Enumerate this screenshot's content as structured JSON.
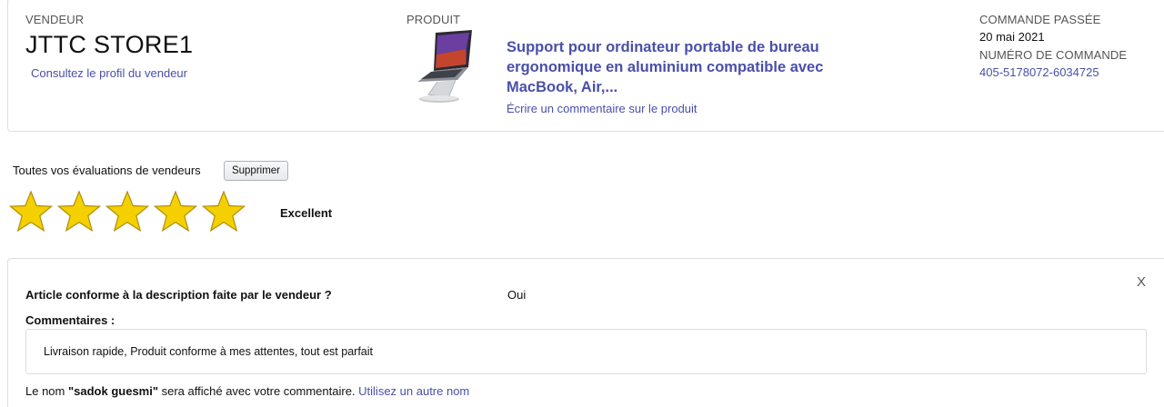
{
  "seller": {
    "heading": "VENDEUR",
    "name": "JTTC STORE1",
    "profile_link": "Consultez le profil du vendeur"
  },
  "product": {
    "heading": "PRODUIT",
    "title": "Support pour ordinateur portable de bureau ergonomique en aluminium compatible avec MacBook, Air,...",
    "review_link": "Écrire un commentaire sur le produit",
    "image_icon": "laptop-stand-image"
  },
  "order": {
    "placed_heading": "COMMANDE PASSÉE",
    "date": "20 mai 2021",
    "number_heading": "NUMÉRO DE COMMANDE",
    "number": "405-5178072-6034725"
  },
  "evaluation": {
    "label": "Toutes vos évaluations de vendeurs",
    "delete_button": "Supprimer",
    "stars_filled": 5,
    "stars_total": 5,
    "rating_text": "Excellent"
  },
  "feedback": {
    "close_label": "X",
    "question": "Article conforme à la description faite par le vendeur ?",
    "answer": "Oui",
    "comments_label": "Commentaires :",
    "comment_text": "Livraison rapide, Produit conforme à mes attentes, tout est parfait",
    "name_prefix": "Le nom ",
    "display_name": "\"sadok guesmi\"",
    "name_suffix": " sera affiché avec votre commentaire. ",
    "change_name_link": "Utilisez un autre nom"
  },
  "colors": {
    "link": "#4a4fa8",
    "star_fill": "#f5d000",
    "star_stroke": "#b08d00",
    "border": "#dddddd"
  }
}
